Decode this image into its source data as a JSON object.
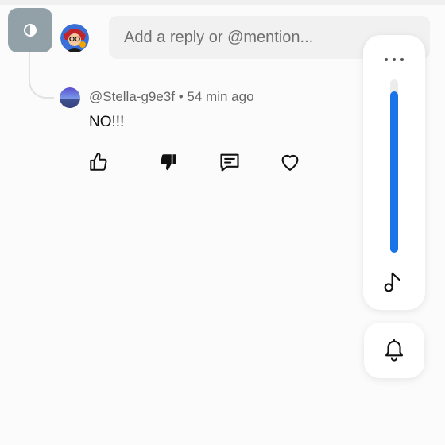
{
  "reply": {
    "placeholder": "Add a reply or @mention..."
  },
  "comment": {
    "username": "@Stella-g9e3f",
    "separator": "•",
    "time": "54 min ago",
    "text": "NO!!!"
  },
  "actions": [
    {
      "name": "like",
      "icon": "thumbs-up-icon"
    },
    {
      "name": "dislike",
      "icon": "thumbs-down-icon"
    },
    {
      "name": "reply",
      "icon": "comment-icon"
    },
    {
      "name": "love",
      "icon": "heart-icon"
    }
  ],
  "side_panel": {
    "volume_level": 0.93,
    "icons": [
      "more-dots-icon",
      "music-note-icon",
      "bell-icon"
    ]
  },
  "colors": {
    "accent": "#1a73e8",
    "toggle_bg": "#8a9aa1"
  }
}
